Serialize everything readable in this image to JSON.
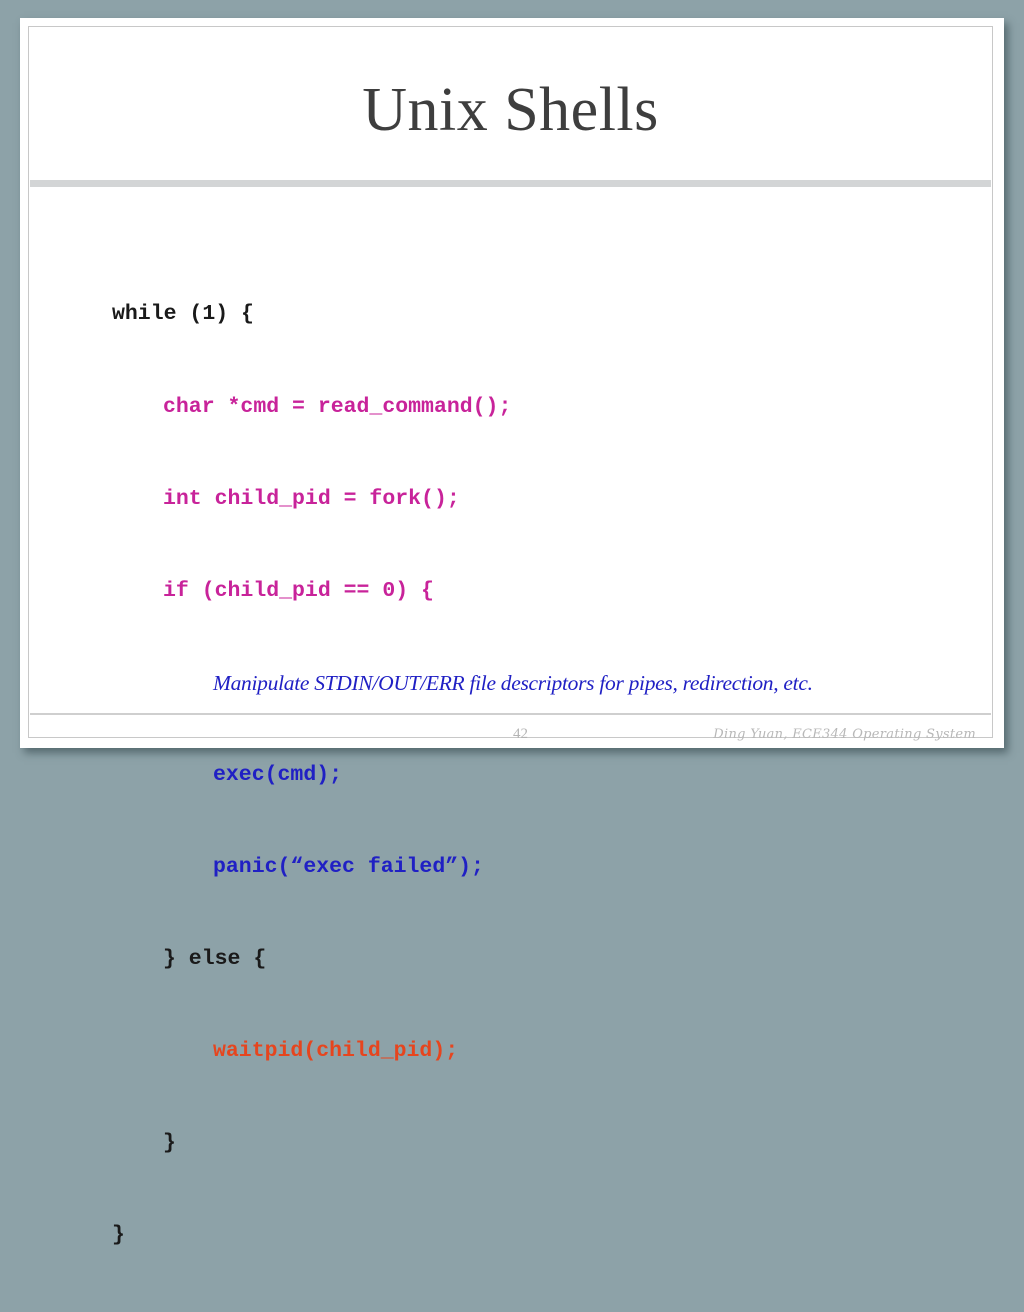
{
  "slide": {
    "title": "Unix Shells",
    "page_number": "42",
    "footer": "Ding Yuan, ECE344 Operating System"
  },
  "colors": {
    "background": "#8da2a8",
    "title": "#3e3e3e",
    "code_default": "#1a1a1a",
    "code_parent_setup": "#c8239a",
    "code_child": "#2020c4",
    "code_parent_wait": "#e6451e"
  },
  "code": {
    "lines": [
      {
        "text": "while (1) {",
        "color": "black",
        "indent": 0
      },
      {
        "text": "char *cmd = read_command();",
        "color": "magenta",
        "indent": 1
      },
      {
        "text": "int child_pid = fork();",
        "color": "magenta",
        "indent": 1
      },
      {
        "text": "if (child_pid == 0) {",
        "color": "magenta",
        "indent": 1
      },
      {
        "text": "Manipulate STDIN/OUT/ERR file descriptors for pipes, redirection, etc.",
        "color": "blue",
        "indent": 2,
        "style": "comment"
      },
      {
        "text": "exec(cmd);",
        "color": "blue",
        "indent": 2
      },
      {
        "text": "panic(“exec failed”);",
        "color": "blue",
        "indent": 2
      },
      {
        "text": "} else {",
        "color": "black",
        "indent": 1
      },
      {
        "text": "waitpid(child_pid);",
        "color": "orange",
        "indent": 2
      },
      {
        "text": "}",
        "color": "black",
        "indent": 1
      },
      {
        "text": "}",
        "color": "black",
        "indent": 0
      }
    ]
  }
}
